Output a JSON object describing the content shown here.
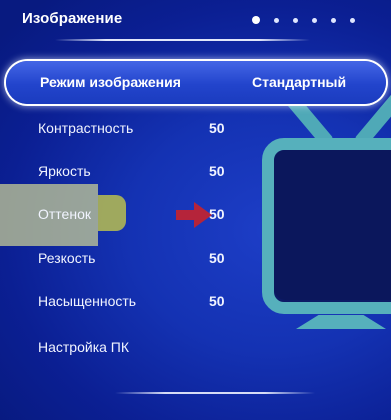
{
  "header": {
    "title": "Изображение",
    "page_indicator": {
      "total": 6,
      "active": 1
    }
  },
  "menu": {
    "selected_index": 0,
    "items": [
      {
        "label": "Режим изображения",
        "value": "Стандартный"
      },
      {
        "label": "Контрастность",
        "value": "50"
      },
      {
        "label": "Яркость",
        "value": "50"
      },
      {
        "label": "Оттенок",
        "value": "50"
      },
      {
        "label": "Резкость",
        "value": "50"
      },
      {
        "label": "Насыщенность",
        "value": "50"
      },
      {
        "label": "Настройка ПК",
        "value": ""
      }
    ]
  },
  "overlay": {
    "highlighted_item": "Оттенок",
    "arrow_color": "#b5243a",
    "highlight_color": "#cdd296"
  },
  "colors": {
    "background": "#1432b3",
    "text": "#ffffff",
    "tv_outline": "#56b0bc"
  },
  "icons": {
    "tv": "tv-illustration-icon",
    "arrow": "arrow-right-icon"
  }
}
